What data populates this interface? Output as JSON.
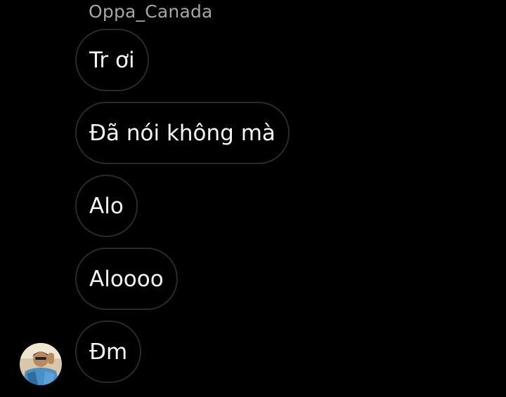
{
  "chat": {
    "sender_name": "Oppa_Canada",
    "messages": [
      {
        "text": "Tr ơi"
      },
      {
        "text": "Đã nói không mà"
      },
      {
        "text": "Alo"
      },
      {
        "text": "Aloooo"
      },
      {
        "text": "Đm"
      }
    ]
  },
  "theme": {
    "background": "#000000",
    "bubble_border": "#2a2a2a",
    "text": "#f5f5f5",
    "sender_name": "#a6a6a6"
  }
}
